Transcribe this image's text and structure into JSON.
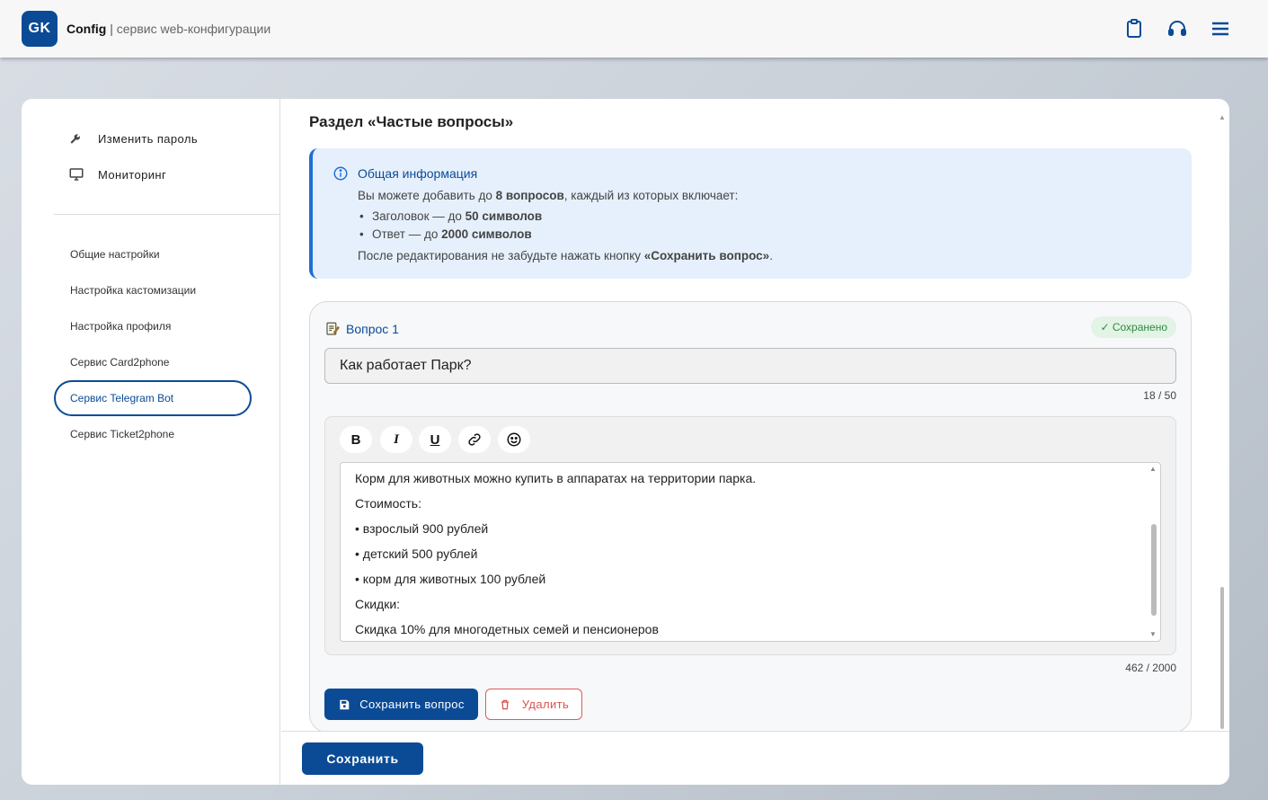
{
  "header": {
    "logo_text": "GK",
    "brand_name": "Config",
    "brand_separator": "|",
    "brand_subtitle": "сервис web-конфигурации",
    "icons": [
      "clipboard-icon",
      "headset-icon",
      "menu-icon"
    ]
  },
  "sidebar": {
    "top_items": [
      {
        "label": "Изменить пароль",
        "icon": "wrench-icon"
      },
      {
        "label": "Мониторинг",
        "icon": "monitor-icon"
      }
    ],
    "items": [
      {
        "label": "Общие настройки"
      },
      {
        "label": "Настройка кастомизации"
      },
      {
        "label": "Настройка профиля"
      },
      {
        "label": "Сервис Card2phone"
      },
      {
        "label": "Сервис Telegram Bot",
        "active": true
      },
      {
        "label": "Сервис Ticket2phone"
      }
    ]
  },
  "main": {
    "section_title": "Раздел «Частые вопросы»",
    "info": {
      "title": "Общая информация",
      "line1_a": "Вы можете добавить до ",
      "line1_b": "8 вопросов",
      "line1_c": ", каждый из которых включает:",
      "bullet1_a": "Заголовок — до ",
      "bullet1_b": "50 символов",
      "bullet2_a": "Ответ — до ",
      "bullet2_b": "2000 символов",
      "line2_a": "После редактирования не забудьте нажать кнопку ",
      "line2_b": "«Сохранить вопрос»",
      "line2_c": "."
    },
    "question": {
      "title": "Вопрос 1",
      "status": "✓ Сохранено",
      "input_value": "Как работает Парк?",
      "title_counter": "18 / 50",
      "toolbar": [
        "B",
        "I",
        "U",
        "link",
        "emoji"
      ],
      "answer_lines": [
        "Корм для животных можно купить в аппаратах на территории парка.",
        "Стоимость:",
        "• взрослый 900 рублей",
        "• детский 500 рублей",
        "• корм для животных 100 рублей",
        "Скидки:",
        "Скидка 10% для многодетных семей и пенсионеров"
      ],
      "answer_counter": "462 / 2000",
      "save_label": "Сохранить вопрос",
      "delete_label": "Удалить"
    },
    "save_label": "Сохранить"
  },
  "colors": {
    "brand": "#0b4b96",
    "info_bg": "#e6f0fc",
    "success": "#2f8a3e",
    "danger": "#d9534f"
  }
}
